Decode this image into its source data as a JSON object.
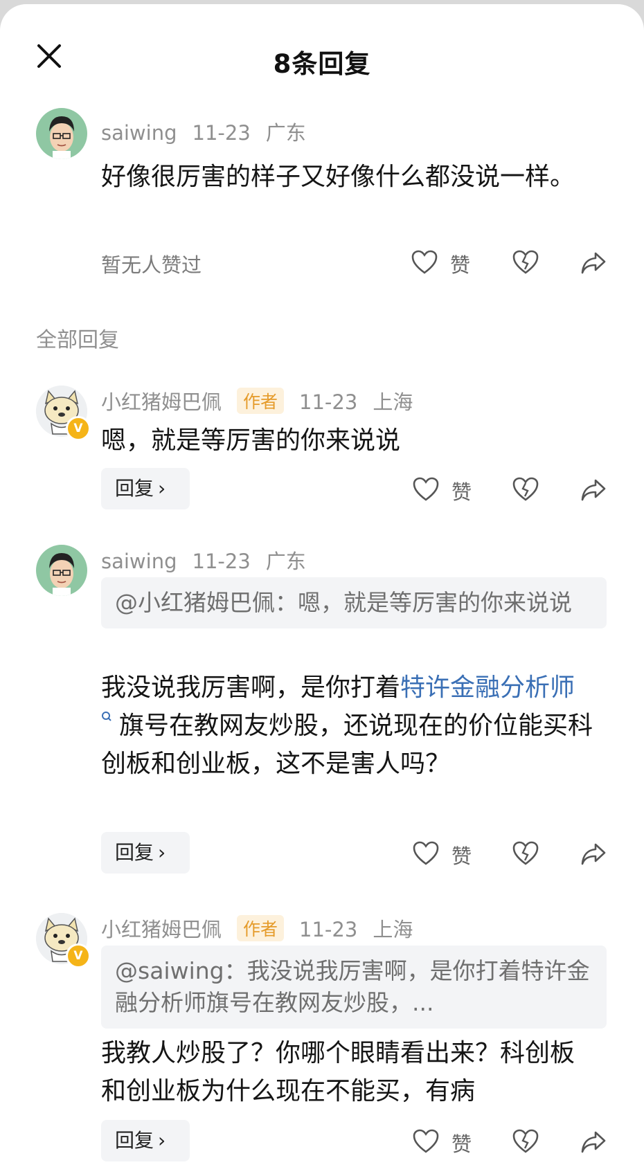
{
  "header": {
    "title": "8条回复"
  },
  "main_comment": {
    "user": "saiwing",
    "date": "11-23",
    "location": "广东",
    "text": "好像很厉害的样子又好像什么都没说一样。",
    "likes_text": "暂无人赞过",
    "like_label": "赞"
  },
  "section_label": "全部回复",
  "replies": [
    {
      "user": "小红猪姆巴佩",
      "tag": "作者",
      "date": "11-23",
      "location": "上海",
      "text": "嗯，就是等厉害的你来说说",
      "reply_label": "回复",
      "like_label": "赞"
    },
    {
      "user": "saiwing",
      "date": "11-23",
      "location": "广东",
      "quote": "@小红猪姆巴佩：嗯，就是等厉害的你来说说",
      "text_before": "我没说我厉害啊，是你打着",
      "link": "特许金融分析师",
      "text_after": "旗号在教网友炒股，还说现在的价位能买科创板和创业板，这不是害人吗？",
      "reply_label": "回复",
      "like_label": "赞"
    },
    {
      "user": "小红猪姆巴佩",
      "tag": "作者",
      "date": "11-23",
      "location": "上海",
      "quote": "@saiwing：我没说我厉害啊，是你打着特许金融分析师旗号在教网友炒股，...",
      "text": "我教人炒股了？你哪个眼睛看出来？科创板和创业板为什么现在不能买，有病",
      "reply_label": "回复",
      "like_label": "赞"
    }
  ],
  "verified_badge": "V",
  "colors": {
    "link": "#3a6fb5",
    "author_tag_bg": "#fdf1dc",
    "author_tag_fg": "#e59b2a",
    "badge": "#f5b418"
  }
}
